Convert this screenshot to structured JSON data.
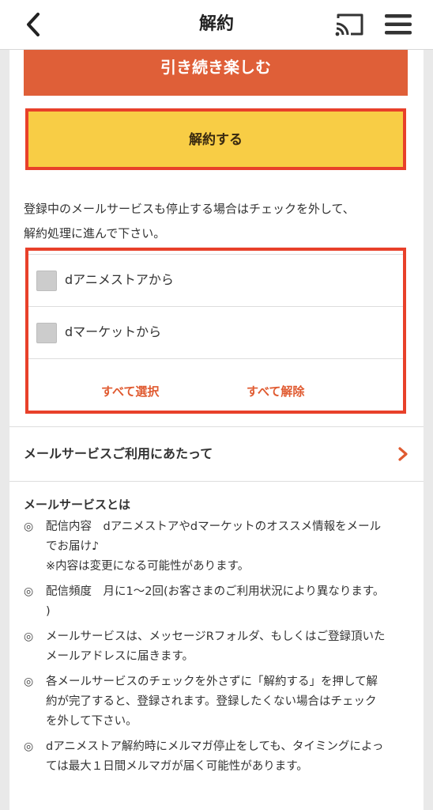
{
  "header": {
    "title": "解約",
    "back_icon": "chevron-left-icon",
    "cast_icon": "cast-icon",
    "menu_icon": "hamburger-menu-icon"
  },
  "actions": {
    "continue_label": "引き続き楽しむ",
    "cancel_label": "解約する"
  },
  "notice": {
    "line1": "登録中のメールサービスも停止する場合はチェックを外して、",
    "line2": "解約処理に進んで下さい。"
  },
  "mail_options": {
    "items": [
      {
        "label": "dアニメストアから",
        "checked": false
      },
      {
        "label": "dマーケットから",
        "checked": false
      }
    ],
    "select_all": "すべて選択",
    "clear_all": "すべて解除"
  },
  "link": {
    "label": "メールサービスご利用にあたって"
  },
  "info": {
    "heading": "メールサービスとは",
    "bullet": "◎",
    "items": [
      {
        "lines": [
          "配信内容　dアニメストアやdマーケットのオススメ情報をメール",
          "でお届け♪",
          "※内容は変更になる可能性があります。"
        ]
      },
      {
        "lines": [
          "配信頻度　月に1〜2回(お客さまのご利用状況により異なります。",
          ")"
        ]
      },
      {
        "lines": [
          "メールサービスは、メッセージRフォルダ、もしくはご登録頂いた",
          "メールアドレスに届きます。"
        ]
      },
      {
        "lines": [
          "各メールサービスのチェックを外さずに「解約する」を押して解",
          "約が完了すると、登録されます。登録したくない場合はチェック",
          "を外して下さい。"
        ]
      },
      {
        "lines": [
          "dアニメストア解約時にメルマガ停止をしても、タイミングによっ",
          "ては最大１日間メルマガが届く可能性があります。"
        ]
      }
    ]
  },
  "colors": {
    "continue_bg": "#df5f38",
    "cancel_bg": "#f8cd45",
    "highlight_border": "#e8402a",
    "accent_text": "#e05a30"
  }
}
